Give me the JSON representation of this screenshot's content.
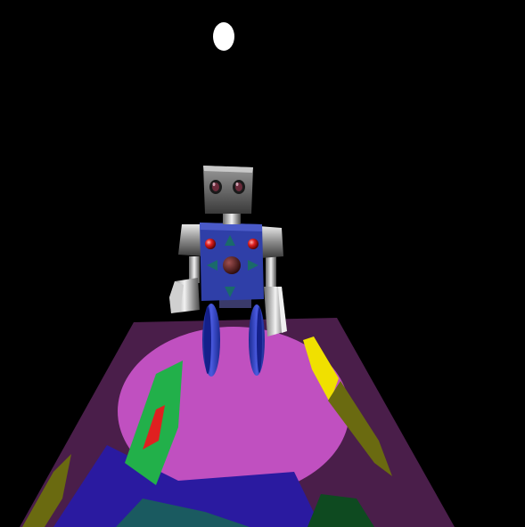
{
  "scene": {
    "background_color": "#000000",
    "light": {
      "color": "#ffffff"
    },
    "floor": {
      "base_color": "#4a1e4a",
      "spot_colors": {
        "magenta": "#c050c0",
        "green": "#22b04a",
        "red": "#e02020",
        "yellow": "#f0e000",
        "olive": "#6a6a10",
        "blue": "#2a1aa0",
        "teal": "#1a5a60",
        "dark_green": "#0e4a20"
      }
    },
    "robot": {
      "body_color": "#2f3fa8",
      "chrome_color": "#cfcfcf",
      "eye_color": "#e02020",
      "core_color": "#5a1a1a",
      "wheel_color": "#2a3fc8"
    }
  }
}
